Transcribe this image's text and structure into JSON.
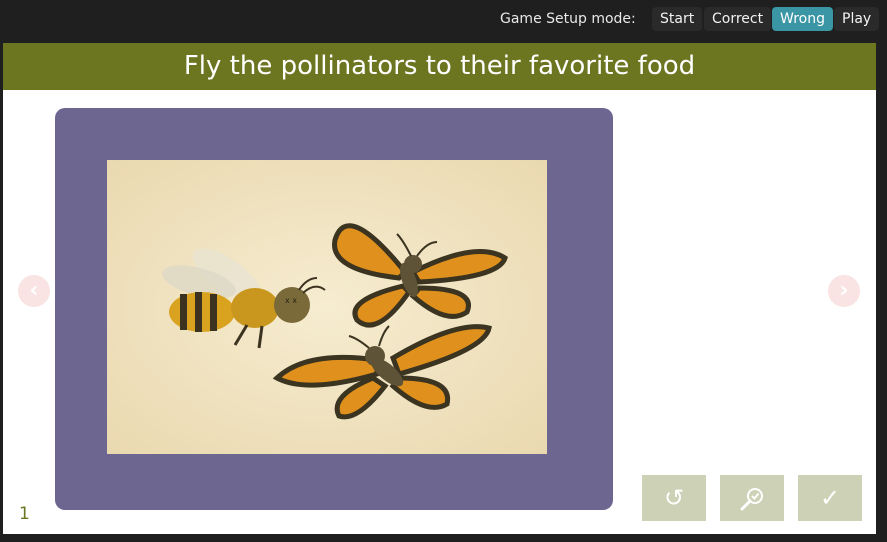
{
  "header": {
    "mode_label": "Game Setup mode:",
    "modes": [
      {
        "label": "Start"
      },
      {
        "label": "Correct"
      },
      {
        "label": "Wrong",
        "active": true
      },
      {
        "label": "Play"
      }
    ]
  },
  "game": {
    "title": "Fly the pollinators to their favorite food",
    "page_number": "1",
    "nav": {
      "prev_icon": "chevron-left-icon",
      "next_icon": "chevron-right-icon"
    },
    "actions": [
      {
        "icon": "reset-icon"
      },
      {
        "icon": "hint-magnifier-icon"
      },
      {
        "icon": "check-icon"
      }
    ]
  },
  "colors": {
    "title_bar": "#6c7621",
    "panel": "#6c6690",
    "active_mode": "#3a95a4",
    "action_button": "#cdd1b6"
  }
}
